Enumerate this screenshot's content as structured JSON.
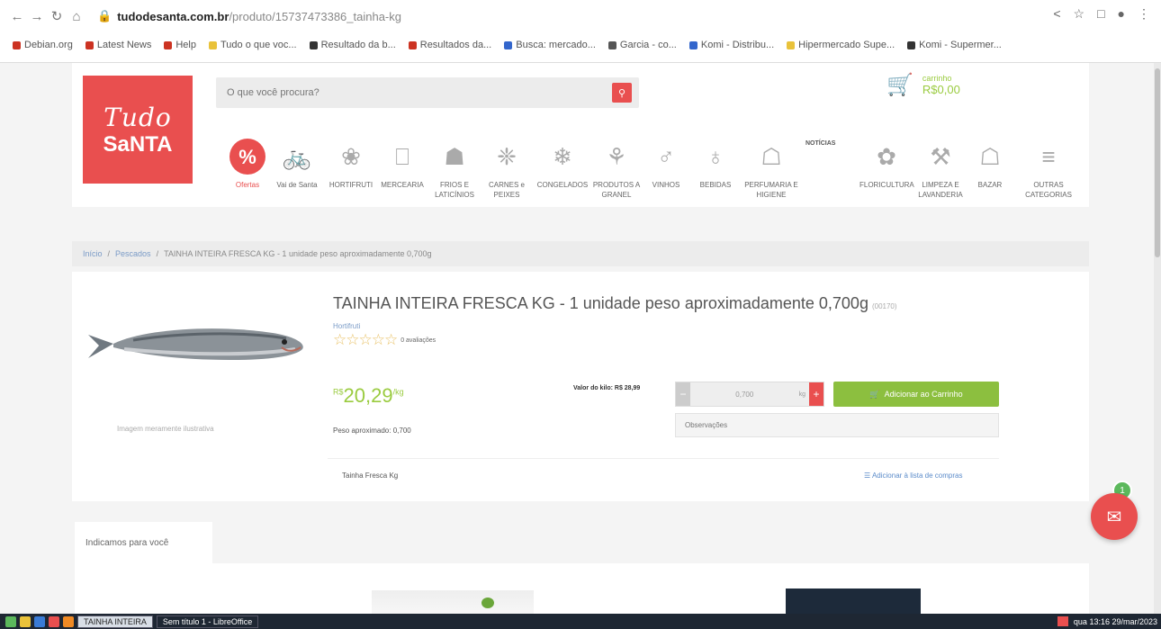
{
  "browser": {
    "url_host": "tudodesanta.com.br",
    "url_path": "/produto/15737473386_tainha-kg",
    "bookmarks": [
      {
        "label": "Debian.org",
        "color": "#c32"
      },
      {
        "label": "Latest News",
        "color": "#c32"
      },
      {
        "label": "Help",
        "color": "#c32"
      },
      {
        "label": "Tudo o que voc...",
        "color": "#e9c23a"
      },
      {
        "label": "Resultado da b...",
        "color": "#333"
      },
      {
        "label": "Resultados da...",
        "color": "#c32"
      },
      {
        "label": "Busca: mercado...",
        "color": "#36c"
      },
      {
        "label": "Garcia - co...",
        "color": "#555"
      },
      {
        "label": "Komi - Distribu...",
        "color": "#36c"
      },
      {
        "label": "Hipermercado Supe...",
        "color": "#e9c23a"
      },
      {
        "label": "Komi - Supermer...",
        "color": "#333"
      }
    ]
  },
  "header": {
    "logo_line1": "Tudo",
    "logo_line2": "SaNTA",
    "search_placeholder": "O que você procura?",
    "search_icon": "search-icon",
    "cart_label": "carrinho",
    "cart_total": "R$0,00",
    "highlight_label": "NOTÍCIAS"
  },
  "categories": [
    {
      "label": "Ofertas",
      "icon": "percent-icon",
      "deal": true
    },
    {
      "label": "Vai de Santa",
      "icon": "bicycle-icon"
    },
    {
      "label": "HORTIFRUTI",
      "icon": "vegetables-icon"
    },
    {
      "label": "MERCEARIA",
      "icon": "grocery-icon"
    },
    {
      "label": "FRIOS E LATICÍNIOS",
      "icon": "dairy-icon"
    },
    {
      "label": "CARNES e PEIXES",
      "icon": "meat-icon"
    },
    {
      "label": "CONGELADOS",
      "icon": "frozen-icon"
    },
    {
      "label": "PRODUTOS A GRANEL",
      "icon": "bulk-icon"
    },
    {
      "label": "VINHOS",
      "icon": "wine-icon"
    },
    {
      "label": "BEBIDAS",
      "icon": "drinks-icon"
    },
    {
      "label": "PERFUMARIA E HIGIENE",
      "icon": "hygiene-icon"
    },
    {
      "label": "FLORICULTURA",
      "icon": "flower-icon"
    },
    {
      "label": "LIMPEZA E LAVANDERIA",
      "icon": "cleaning-icon"
    },
    {
      "label": "BAZAR",
      "icon": "bazaar-icon"
    },
    {
      "label": "OUTRAS CATEGORIAS",
      "icon": "menu-icon"
    }
  ],
  "breadcrumb": {
    "home": "Início",
    "section": "Pescados",
    "current": "TAINHA INTEIRA FRESCA KG - 1 unidade peso aproximadamente 0,700g"
  },
  "product": {
    "title": "TAINHA INTEIRA FRESCA KG - 1 unidade peso aproximadamente 0,700g",
    "sku": "(00170)",
    "brand": "Hortifruti",
    "rating_stars": "☆☆☆☆☆",
    "reviews": "0 avaliações",
    "price": "20,29",
    "price_prefix": "R$",
    "price_unit": "/kg",
    "weight_note": "Peso aproximado: 0,700",
    "unit_price": "Valor do kilo: R$ 28,99",
    "qty_value": "0,700",
    "qty_unit": "kg",
    "add_to_cart": "Adicionar ao Carrinho",
    "obs_placeholder": "Observações",
    "image_caption": "Imagem meramente ilustrativa",
    "short_name": "Tainha Fresca Kg",
    "add_to_list": "Adicionar à lista de compras"
  },
  "recommendations": {
    "tab_label": "Indicamos para você"
  },
  "chat": {
    "badge": "1"
  },
  "taskbar": {
    "windows": [
      {
        "label": "TAINHA INTEIRA",
        "active": true
      },
      {
        "label": "Sem título 1 - LibreOffice",
        "active": false
      }
    ],
    "clock": "qua 13:16 29/mar/2023"
  },
  "colors": {
    "brand_red": "#e94f4f",
    "brand_green": "#8cbf3f"
  }
}
